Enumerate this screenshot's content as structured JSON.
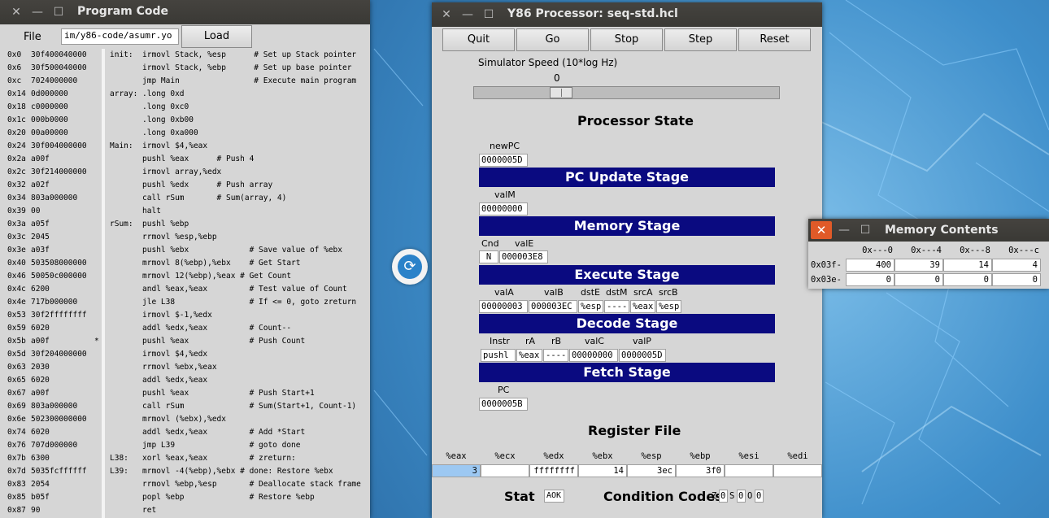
{
  "program_window": {
    "title": "Program Code",
    "file_label": "File",
    "file_value": "im/y86-code/asumr.yo",
    "load_label": "Load",
    "lines": [
      {
        "addr": "0x0",
        "bytes": "30f400040000",
        "mark": "",
        "src": "init:  irmovl Stack, %esp      # Set up Stack pointer"
      },
      {
        "addr": "0x6",
        "bytes": "30f500040000",
        "mark": "",
        "src": "       irmovl Stack, %ebp      # Set up base pointer"
      },
      {
        "addr": "0xc",
        "bytes": "7024000000",
        "mark": "",
        "src": "       jmp Main                # Execute main program"
      },
      {
        "addr": "0x14",
        "bytes": "0d000000",
        "mark": "",
        "src": "array: .long 0xd"
      },
      {
        "addr": "0x18",
        "bytes": "c0000000",
        "mark": "",
        "src": "       .long 0xc0"
      },
      {
        "addr": "0x1c",
        "bytes": "000b0000",
        "mark": "",
        "src": "       .long 0xb00"
      },
      {
        "addr": "0x20",
        "bytes": "00a00000",
        "mark": "",
        "src": "       .long 0xa000"
      },
      {
        "addr": "0x24",
        "bytes": "30f004000000",
        "mark": "",
        "src": "Main:  irmovl $4,%eax"
      },
      {
        "addr": "0x2a",
        "bytes": "a00f",
        "mark": "",
        "src": "       pushl %eax      # Push 4"
      },
      {
        "addr": "0x2c",
        "bytes": "30f214000000",
        "mark": "",
        "src": "       irmovl array,%edx"
      },
      {
        "addr": "0x32",
        "bytes": "a02f",
        "mark": "",
        "src": "       pushl %edx      # Push array"
      },
      {
        "addr": "0x34",
        "bytes": "803a000000",
        "mark": "",
        "src": "       call rSum       # Sum(array, 4)"
      },
      {
        "addr": "0x39",
        "bytes": "00",
        "mark": "",
        "src": "       halt"
      },
      {
        "addr": "0x3a",
        "bytes": "a05f",
        "mark": "",
        "src": "rSum:  pushl %ebp"
      },
      {
        "addr": "0x3c",
        "bytes": "2045",
        "mark": "",
        "src": "       rrmovl %esp,%ebp"
      },
      {
        "addr": "0x3e",
        "bytes": "a03f",
        "mark": "",
        "src": "       pushl %ebx             # Save value of %ebx"
      },
      {
        "addr": "0x40",
        "bytes": "503508000000",
        "mark": "",
        "src": "       mrmovl 8(%ebp),%ebx    # Get Start"
      },
      {
        "addr": "0x46",
        "bytes": "50050c000000",
        "mark": "",
        "src": "       mrmovl 12(%ebp),%eax # Get Count"
      },
      {
        "addr": "0x4c",
        "bytes": "6200",
        "mark": "",
        "src": "       andl %eax,%eax         # Test value of Count"
      },
      {
        "addr": "0x4e",
        "bytes": "717b000000",
        "mark": "",
        "src": "       jle L38                # If <= 0, goto zreturn"
      },
      {
        "addr": "0x53",
        "bytes": "30f2ffffffff",
        "mark": "",
        "src": "       irmovl $-1,%edx"
      },
      {
        "addr": "0x59",
        "bytes": "6020",
        "mark": "",
        "src": "       addl %edx,%eax         # Count--"
      },
      {
        "addr": "0x5b",
        "bytes": "a00f",
        "mark": "*",
        "src": "       pushl %eax             # Push Count"
      },
      {
        "addr": "0x5d",
        "bytes": "30f204000000",
        "mark": "",
        "src": "       irmovl $4,%edx"
      },
      {
        "addr": "0x63",
        "bytes": "2030",
        "mark": "",
        "src": "       rrmovl %ebx,%eax"
      },
      {
        "addr": "0x65",
        "bytes": "6020",
        "mark": "",
        "src": "       addl %edx,%eax"
      },
      {
        "addr": "0x67",
        "bytes": "a00f",
        "mark": "",
        "src": "       pushl %eax             # Push Start+1"
      },
      {
        "addr": "0x69",
        "bytes": "803a000000",
        "mark": "",
        "src": "       call rSum              # Sum(Start+1, Count-1)"
      },
      {
        "addr": "0x6e",
        "bytes": "502300000000",
        "mark": "",
        "src": "       mrmovl (%ebx),%edx"
      },
      {
        "addr": "0x74",
        "bytes": "6020",
        "mark": "",
        "src": "       addl %edx,%eax         # Add *Start"
      },
      {
        "addr": "0x76",
        "bytes": "707d000000",
        "mark": "",
        "src": "       jmp L39                # goto done"
      },
      {
        "addr": "0x7b",
        "bytes": "6300",
        "mark": "",
        "src": "L38:   xorl %eax,%eax         # zreturn:"
      },
      {
        "addr": "0x7d",
        "bytes": "5035fcffffff",
        "mark": "",
        "src": "L39:   mrmovl -4(%ebp),%ebx # done: Restore %ebx"
      },
      {
        "addr": "0x83",
        "bytes": "2054",
        "mark": "",
        "src": "       rrmovl %ebp,%esp       # Deallocate stack frame"
      },
      {
        "addr": "0x85",
        "bytes": "b05f",
        "mark": "",
        "src": "       popl %ebp              # Restore %ebp"
      },
      {
        "addr": "0x87",
        "bytes": "90",
        "mark": "",
        "src": "       ret"
      }
    ]
  },
  "processor_window": {
    "title": "Y86 Processor: seq-std.hcl",
    "buttons": {
      "quit": "Quit",
      "go": "Go",
      "stop": "Stop",
      "step": "Step",
      "reset": "Reset"
    },
    "speed_label": "Simulator Speed (10*log Hz)",
    "speed_value": "0",
    "speed_fraction": 0.27,
    "processor_state_heading": "Processor State",
    "newpc": {
      "label": "newPC",
      "value": "0000005D"
    },
    "pc_update_stage": "PC Update Stage",
    "valm": {
      "label": "valM",
      "value": "00000000"
    },
    "memory_stage": "Memory Stage",
    "cnd": {
      "label": "Cnd",
      "value": "N"
    },
    "vale": {
      "label": "valE",
      "value": "000003E8"
    },
    "execute_stage": "Execute Stage",
    "decode": {
      "vala": {
        "label": "valA",
        "value": "00000003"
      },
      "valb": {
        "label": "valB",
        "value": "000003EC"
      },
      "dste": {
        "label": "dstE",
        "value": "%esp"
      },
      "dstm": {
        "label": "dstM",
        "value": "----"
      },
      "srca": {
        "label": "srcA",
        "value": "%eax"
      },
      "srcb": {
        "label": "srcB",
        "value": "%esp"
      }
    },
    "decode_stage": "Decode Stage",
    "fetch": {
      "instr": {
        "label": "Instr",
        "value": "pushl"
      },
      "ra": {
        "label": "rA",
        "value": "%eax"
      },
      "rb": {
        "label": "rB",
        "value": "----"
      },
      "valc": {
        "label": "valC",
        "value": "00000000"
      },
      "valp": {
        "label": "valP",
        "value": "0000005D"
      }
    },
    "fetch_stage": "Fetch Stage",
    "pc": {
      "label": "PC",
      "value": "0000005B"
    },
    "register_file_heading": "Register File",
    "registers": [
      {
        "name": "%eax",
        "value": "3"
      },
      {
        "name": "%ecx",
        "value": ""
      },
      {
        "name": "%edx",
        "value": "ffffffff"
      },
      {
        "name": "%ebx",
        "value": "14"
      },
      {
        "name": "%esp",
        "value": "3ec"
      },
      {
        "name": "%ebp",
        "value": "3f0"
      },
      {
        "name": "%esi",
        "value": ""
      },
      {
        "name": "%edi",
        "value": ""
      }
    ],
    "stat_label": "Stat",
    "stat_value": "AOK",
    "cc_label": "Condition Codes",
    "cc": {
      "z_label": "Z",
      "z": "0",
      "s_label": "S",
      "s": "0",
      "o_label": "O",
      "o": "0"
    }
  },
  "memory_window": {
    "title": "Memory Contents",
    "columns": [
      "0x---0",
      "0x---4",
      "0x---8",
      "0x---c"
    ],
    "rows": [
      {
        "addr": "0x03f-",
        "cells": [
          "400",
          "39",
          "14",
          "4"
        ]
      },
      {
        "addr": "0x03e-",
        "cells": [
          "0",
          "0",
          "0",
          "0"
        ]
      }
    ]
  },
  "colors": {
    "stage_bar": "#0a0a80",
    "eax_highlight": "#9cc8f2",
    "close_orange": "#e05a28"
  }
}
